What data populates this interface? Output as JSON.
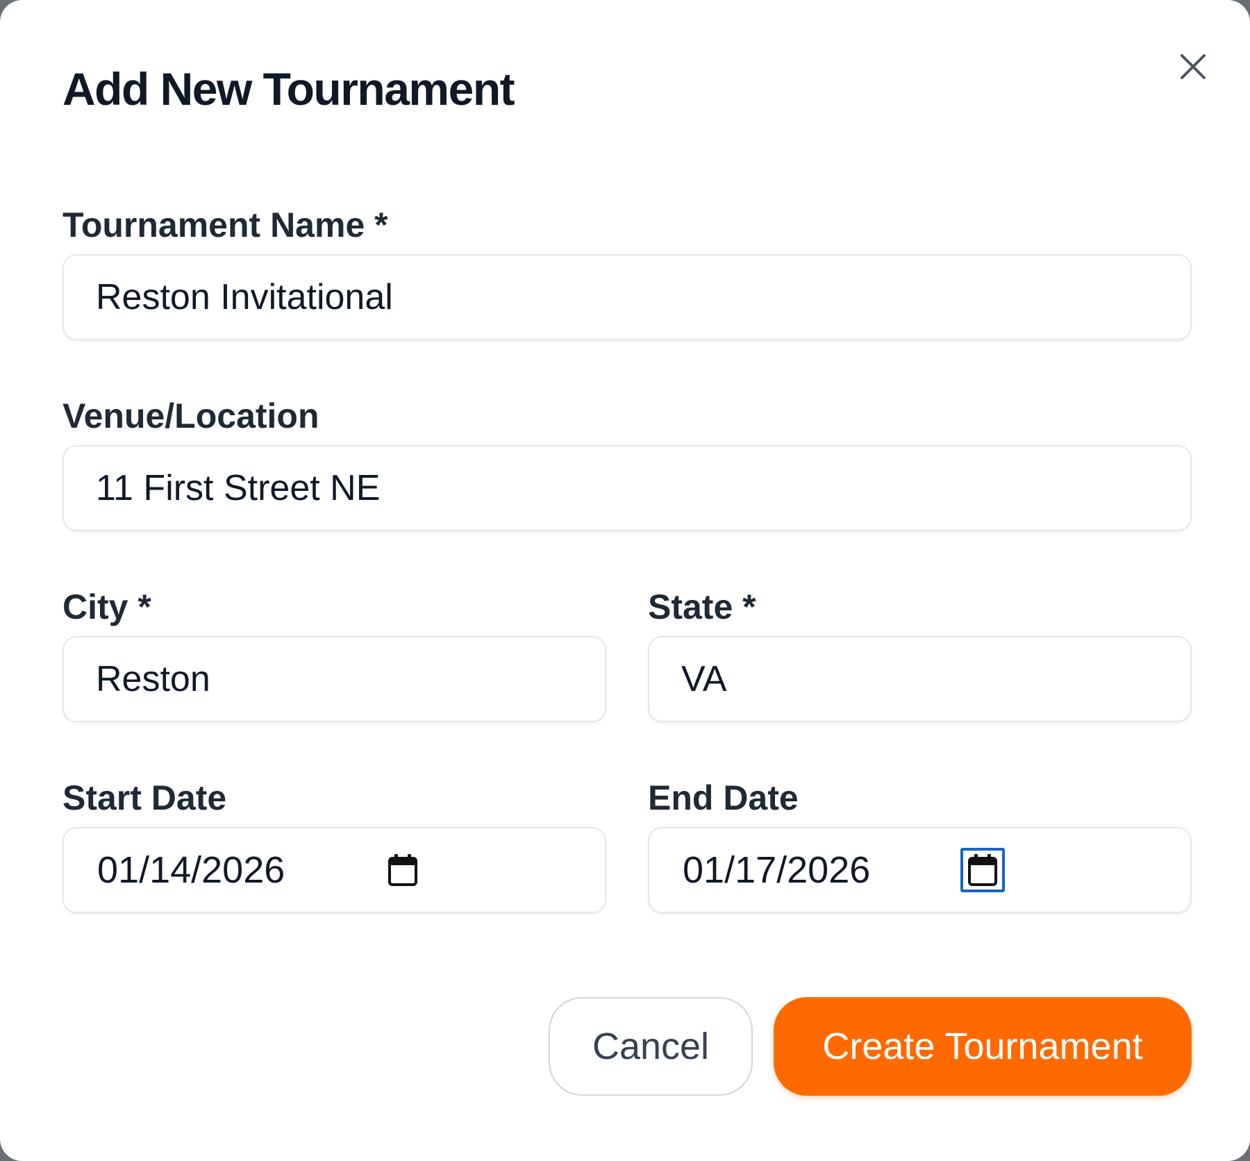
{
  "dialog": {
    "title": "Add New Tournament",
    "close_icon": "close-icon"
  },
  "form": {
    "tournament_name": {
      "label": "Tournament Name *",
      "value": "Reston Invitational"
    },
    "venue": {
      "label": "Venue/Location",
      "value": "11 First Street NE"
    },
    "city": {
      "label": "City *",
      "value": "Reston"
    },
    "state": {
      "label": "State *",
      "value": "VA"
    },
    "start_date": {
      "label": "Start Date",
      "value": "01/14/2026",
      "icon": "calendar-icon"
    },
    "end_date": {
      "label": "End Date",
      "value": "01/17/2026",
      "icon": "calendar-icon"
    }
  },
  "actions": {
    "cancel_label": "Cancel",
    "create_label": "Create Tournament"
  },
  "colors": {
    "primary": "#ff6a00",
    "focus_ring": "#1565c0",
    "title_text": "#111827",
    "input_border": "#e5e7eb"
  }
}
